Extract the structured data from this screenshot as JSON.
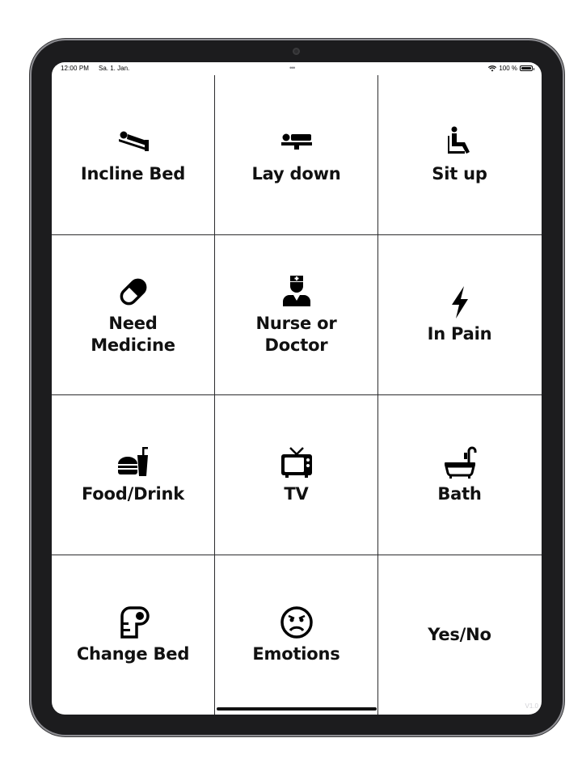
{
  "status_bar": {
    "time": "12:00 PM",
    "date": "Sa. 1. Jan.",
    "multitask_dots": "•••",
    "battery_text": "100 %",
    "battery_level_percent": 100
  },
  "tiles": [
    {
      "label": "Incline Bed",
      "icon": "incline-bed-icon"
    },
    {
      "label": "Lay down",
      "icon": "bed-icon"
    },
    {
      "label": "Sit up",
      "icon": "sitting-person-icon"
    },
    {
      "label": "Need\nMedicine",
      "icon": "pill-icon"
    },
    {
      "label": "Nurse or\nDoctor",
      "icon": "nurse-icon"
    },
    {
      "label": "In Pain",
      "icon": "lightning-bolt-icon"
    },
    {
      "label": "Food/Drink",
      "icon": "food-drink-icon"
    },
    {
      "label": "TV",
      "icon": "tv-icon"
    },
    {
      "label": "Bath",
      "icon": "bathtub-icon"
    },
    {
      "label": "Change Bed",
      "icon": "toilet-paper-icon"
    },
    {
      "label": "Emotions",
      "icon": "sad-face-icon"
    },
    {
      "label": "Yes/No",
      "icon": ""
    }
  ],
  "version": "V1.0"
}
